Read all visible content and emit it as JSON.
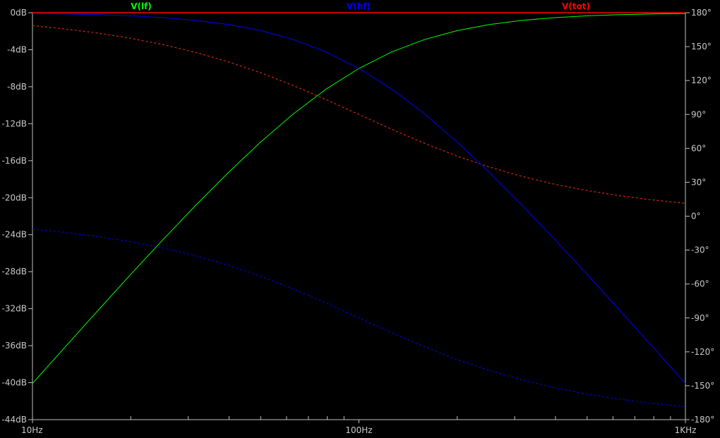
{
  "chart_data": {
    "type": "line",
    "title": "",
    "x_scale": "log",
    "xlim": [
      10,
      1000
    ],
    "x_ticks": [
      "10Hz",
      "100Hz",
      "1KHz"
    ],
    "left_axis": {
      "unit": "dB",
      "ylim": [
        -44,
        0
      ],
      "ticks": [
        "0dB",
        "-4dB",
        "-8dB",
        "-12dB",
        "-16dB",
        "-20dB",
        "-24dB",
        "-28dB",
        "-32dB",
        "-36dB",
        "-40dB",
        "-44dB"
      ]
    },
    "right_axis": {
      "unit": "deg",
      "ylim": [
        -180,
        180
      ],
      "ticks": [
        "180°",
        "150°",
        "120°",
        "90°",
        "60°",
        "30°",
        "0°",
        "-30°",
        "-60°",
        "-90°",
        "-120°",
        "-150°",
        "-180°"
      ]
    },
    "x": [
      10,
      12.59,
      15.85,
      19.95,
      25.12,
      31.62,
      39.81,
      50.12,
      63.1,
      79.43,
      100,
      125.9,
      158.5,
      199.5,
      251.2,
      316.2,
      398.1,
      501.2,
      631.0,
      794.3,
      1000
    ],
    "series": [
      {
        "name": "V(lf)",
        "color": "#00ff00",
        "magnitude_db": [
          -40.086,
          -36.137,
          -32.215,
          -28.339,
          -24.532,
          -20.828,
          -17.278,
          -13.947,
          -10.91,
          -8.249,
          -6.021,
          -4.249,
          -2.91,
          -1.947,
          -1.278,
          -0.828,
          -0.532,
          -0.339,
          -0.215,
          -0.137,
          -0.086
        ],
        "phase_deg": [
          168.58,
          165.65,
          161.99,
          157.43,
          151.8,
          144.9,
          136.6,
          126.76,
          115.5,
          103.08,
          90,
          76.92,
          64.5,
          53.24,
          43.4,
          35.1,
          28.2,
          22.57,
          18.01,
          14.35,
          11.42
        ]
      },
      {
        "name": "V(hf)",
        "color": "#0000ff",
        "magnitude_db": [
          -0.086,
          -0.137,
          -0.215,
          -0.339,
          -0.532,
          -0.828,
          -1.278,
          -1.947,
          -2.91,
          -4.249,
          -6.021,
          -8.249,
          -10.911,
          -13.947,
          -17.279,
          -20.828,
          -24.532,
          -28.34,
          -32.215,
          -36.137,
          -40.086
        ],
        "phase_deg": [
          -11.42,
          -14.35,
          -18.01,
          -22.57,
          -28.2,
          -35.1,
          -43.4,
          -53.24,
          -64.5,
          -76.92,
          -90,
          -103.08,
          -115.5,
          -126.76,
          -136.6,
          -144.9,
          -151.8,
          -157.43,
          -161.99,
          -165.65,
          -168.58
        ]
      },
      {
        "name": "V(tot)",
        "color": "#ff0000",
        "magnitude_db": [
          0,
          0,
          0,
          0,
          0,
          0,
          0,
          0,
          0,
          0,
          0,
          0,
          0,
          0,
          0,
          0,
          0,
          0,
          0,
          0,
          0
        ],
        "phase_deg": [
          168.58,
          165.65,
          161.99,
          157.43,
          151.8,
          144.9,
          136.6,
          126.76,
          115.5,
          103.08,
          90,
          76.92,
          64.5,
          53.24,
          43.4,
          35.1,
          28.2,
          22.57,
          18.01,
          14.35,
          11.42
        ]
      }
    ],
    "legend_placement": "top",
    "grid": false,
    "axis_color": "#c0c0c0",
    "background": "#000000"
  }
}
